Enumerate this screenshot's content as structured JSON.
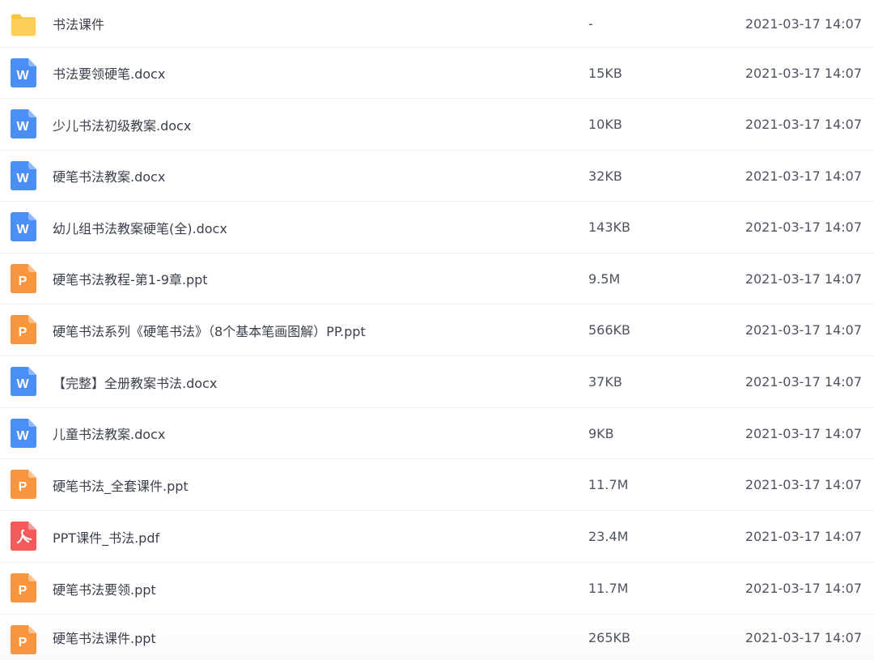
{
  "files": [
    {
      "name": "书法课件",
      "size": "-",
      "date": "2021-03-17 14:07",
      "type": "folder",
      "icon": "folder-icon",
      "icon_letter": ""
    },
    {
      "name": "书法要领硬笔.docx",
      "size": "15KB",
      "date": "2021-03-17 14:07",
      "type": "word",
      "icon": "word-document-icon",
      "icon_letter": "W"
    },
    {
      "name": "少儿书法初级教案.docx",
      "size": "10KB",
      "date": "2021-03-17 14:07",
      "type": "word",
      "icon": "word-document-icon",
      "icon_letter": "W"
    },
    {
      "name": "硬笔书法教案.docx",
      "size": "32KB",
      "date": "2021-03-17 14:07",
      "type": "word",
      "icon": "word-document-icon",
      "icon_letter": "W"
    },
    {
      "name": "幼儿组书法教案硬笔(全).docx",
      "size": "143KB",
      "date": "2021-03-17 14:07",
      "type": "word",
      "icon": "word-document-icon",
      "icon_letter": "W"
    },
    {
      "name": "硬笔书法教程-第1-9章.ppt",
      "size": "9.5M",
      "date": "2021-03-17 14:07",
      "type": "ppt",
      "icon": "powerpoint-document-icon",
      "icon_letter": "P"
    },
    {
      "name": "硬笔书法系列《硬笔书法》（8个基本笔画图解）PP.ppt",
      "size": "566KB",
      "date": "2021-03-17 14:07",
      "type": "ppt",
      "icon": "powerpoint-document-icon",
      "icon_letter": "P"
    },
    {
      "name": "【完整】全册教案书法.docx",
      "size": "37KB",
      "date": "2021-03-17 14:07",
      "type": "word",
      "icon": "word-document-icon",
      "icon_letter": "W"
    },
    {
      "name": "儿童书法教案.docx",
      "size": "9KB",
      "date": "2021-03-17 14:07",
      "type": "word",
      "icon": "word-document-icon",
      "icon_letter": "W"
    },
    {
      "name": "硬笔书法_全套课件.ppt",
      "size": "11.7M",
      "date": "2021-03-17 14:07",
      "type": "ppt",
      "icon": "powerpoint-document-icon",
      "icon_letter": "P"
    },
    {
      "name": "PPT课件_书法.pdf",
      "size": "23.4M",
      "date": "2021-03-17 14:07",
      "type": "pdf",
      "icon": "pdf-document-icon",
      "icon_letter": ""
    },
    {
      "name": "硬笔书法要领.ppt",
      "size": "11.7M",
      "date": "2021-03-17 14:07",
      "type": "ppt",
      "icon": "powerpoint-document-icon",
      "icon_letter": "P"
    },
    {
      "name": "硬笔书法课件.ppt",
      "size": "265KB",
      "date": "2021-03-17 14:07",
      "type": "ppt",
      "icon": "powerpoint-document-icon",
      "icon_letter": "P"
    }
  ],
  "colors": {
    "folder": "#fcd058",
    "folder_tab": "#f7c33d",
    "word": "#4b8ff6",
    "word_fold": "#8fb9fa",
    "ppt": "#f8953f",
    "ppt_fold": "#fbc08c",
    "pdf": "#f25b5b",
    "pdf_fold": "#f79d9d"
  }
}
